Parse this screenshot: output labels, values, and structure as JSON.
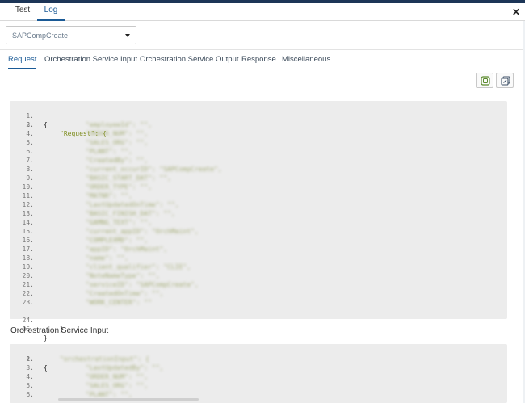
{
  "top_tabs": [
    {
      "label": "Test"
    },
    {
      "label": "Log"
    }
  ],
  "active_top_tab": "Log",
  "select": {
    "value": "SAPCompCreate"
  },
  "sub_tabs": [
    {
      "label": "Request"
    },
    {
      "label": "Orchestration Service Input"
    },
    {
      "label": "Orchestration Service Output"
    },
    {
      "label": "Response"
    },
    {
      "label": "Miscellaneous"
    }
  ],
  "active_sub_tab": "Request",
  "toolbar": {
    "copy_icon": "copy-icon",
    "expand_icon": "popout-icon"
  },
  "request_block": {
    "line_numbers": [
      "1.",
      "2.",
      "3.",
      "4.",
      "5.",
      "6.",
      "7.",
      "8.",
      "9.",
      "10.",
      "11.",
      "12.",
      "13.",
      "14.",
      "15.",
      "16.",
      "17.",
      "18.",
      "19.",
      "20.",
      "21.",
      "22.",
      "23.",
      "24.",
      "25."
    ],
    "open_brace": "{",
    "request_key": "\"Request\": {",
    "blurred_lines": [
      "\"employeeId\": \"\",",
      "\"ORDER_NUM\": \"\",",
      "\"SALES_ORG\": \"\",",
      "\"PLANT\": \"\",",
      "\"CreatedBy\": \"\",",
      "\"current_occurID\": \"SAPCompCreate\",",
      "\"BASIC_START_DAT\": \"\",",
      "\"ORDER_TYPE\": \"\",",
      "\"MATNR\": \"\",",
      "\"LastUpdatedOnTime\": \"\",",
      "\"BASIC_FINISH_DAT\": \"\",",
      "\"GAMNG_TEXT\": \"\",",
      "\"current_appID\": \"OrchMaint\",",
      "\"COMPLEXMD\": \"\",",
      "\"appID\": \"OrchMaint\",",
      "\"name\": \"\",",
      "\"client_qualifier\": \"CLIE\",",
      "\"NoteNameType\": \"\",",
      "\"serviceID\": \"SAPCompCreate\",",
      "\"CreatedOnTime\": \"\",",
      "\"WORK_CENTER\": \"\""
    ],
    "close_inner": "}",
    "close_outer": "}"
  },
  "section_title": "Orchestration Service Input",
  "input_block": {
    "line_numbers": [
      "1.",
      "2.",
      "3.",
      "4.",
      "5.",
      "6."
    ],
    "open_brace": "{",
    "blurred_lines": [
      "\"orchestrationInput\": {",
      "\"LastUpdatedBy\": \"\",",
      "\"ORDER_NUM\": \"\",",
      "\"SALES_ORG\": \"\",",
      "\"PLANT\": \"\","
    ]
  },
  "close_icon": "close-icon"
}
